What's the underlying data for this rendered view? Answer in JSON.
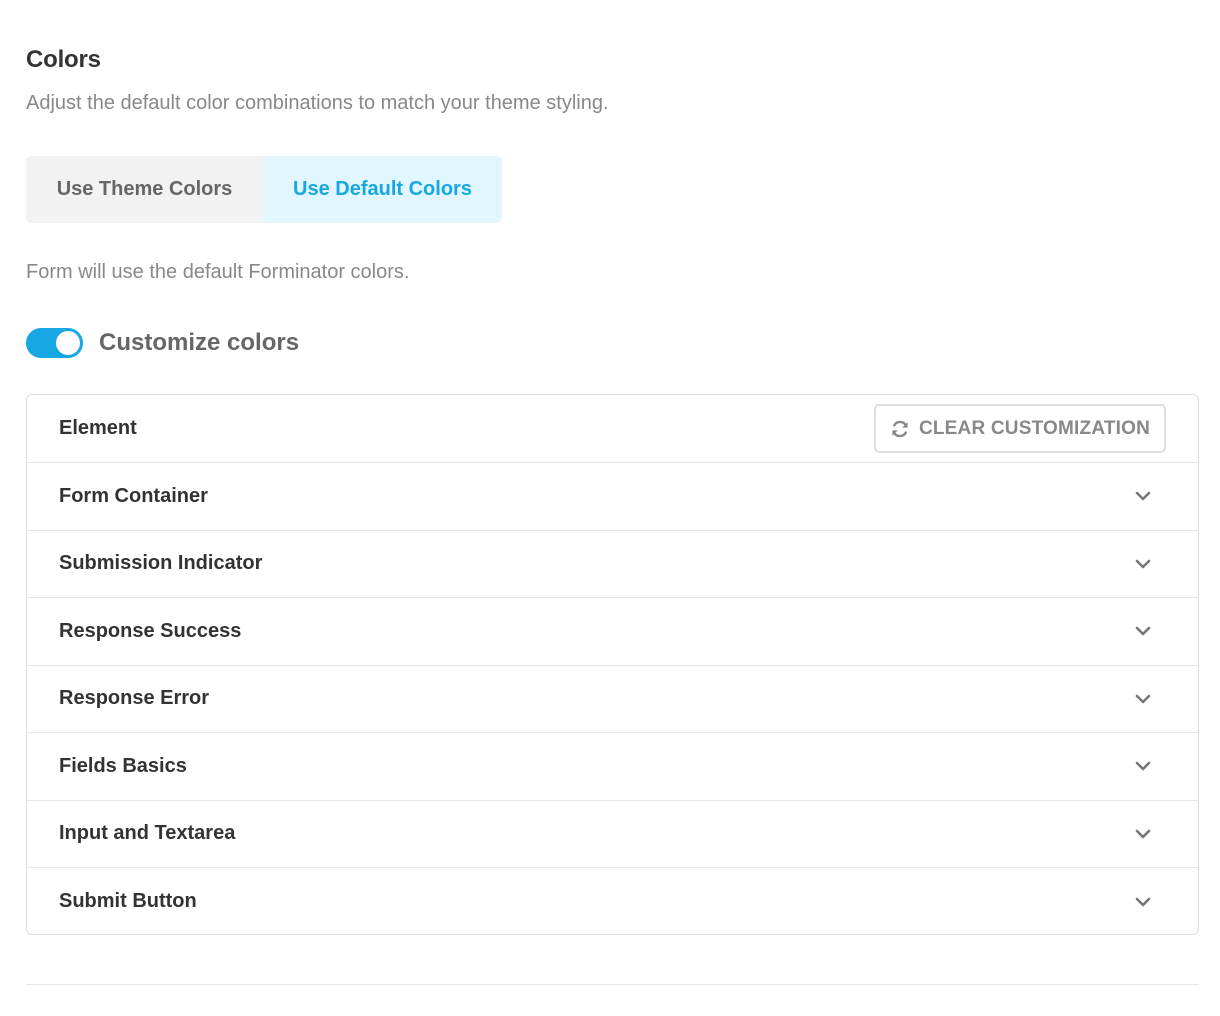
{
  "section": {
    "title": "Colors",
    "description": "Adjust the default color combinations to match your theme styling."
  },
  "tabs": [
    {
      "label": "Use Theme Colors",
      "active": false
    },
    {
      "label": "Use Default Colors",
      "active": true
    }
  ],
  "tab_note": "Form will use the default Forminator colors.",
  "customize": {
    "label": "Customize colors",
    "enabled": true
  },
  "panel": {
    "header_label": "Element",
    "clear_button_label": "CLEAR CUSTOMIZATION",
    "clear_icon": "refresh-icon",
    "rows": [
      {
        "label": "Form Container",
        "icon": "chevron-down-icon"
      },
      {
        "label": "Submission Indicator",
        "icon": "chevron-down-icon"
      },
      {
        "label": "Response Success",
        "icon": "chevron-down-icon"
      },
      {
        "label": "Response Error",
        "icon": "chevron-down-icon"
      },
      {
        "label": "Fields Basics",
        "icon": "chevron-down-icon"
      },
      {
        "label": "Input and Textarea",
        "icon": "chevron-down-icon"
      },
      {
        "label": "Submit Button",
        "icon": "chevron-down-icon"
      }
    ]
  },
  "colors": {
    "accent": "#17a8e3",
    "accent_bg": "#e1f6ff",
    "text": "#333333",
    "muted": "#888888",
    "border": "#dddddd"
  }
}
